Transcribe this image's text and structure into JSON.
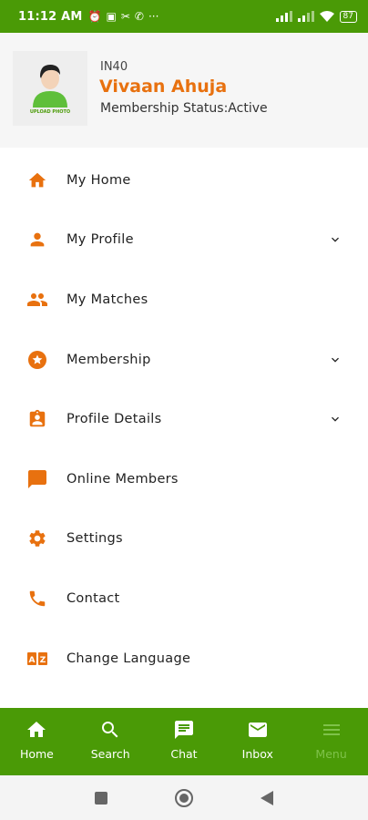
{
  "status_bar": {
    "time": "11:12 AM",
    "battery": "87"
  },
  "profile": {
    "upload_text": "UPLOAD PHOTO",
    "id": "IN40",
    "name": "Vivaan Ahuja",
    "status": "Membership Status:Active"
  },
  "colors": {
    "accent": "#e8710f",
    "brand_green": "#4a9a06"
  },
  "menu": {
    "items": [
      {
        "label": "My Home",
        "icon": "home-icon",
        "expandable": false
      },
      {
        "label": "My Profile",
        "icon": "person-icon",
        "expandable": true
      },
      {
        "label": "My Matches",
        "icon": "people-icon",
        "expandable": false
      },
      {
        "label": "Membership",
        "icon": "star-circle-icon",
        "expandable": true
      },
      {
        "label": "Profile Details",
        "icon": "badge-icon",
        "expandable": true
      },
      {
        "label": "Online Members",
        "icon": "chat-bubble-icon",
        "expandable": false
      },
      {
        "label": "Settings",
        "icon": "gear-icon",
        "expandable": false
      },
      {
        "label": "Contact",
        "icon": "phone-icon",
        "expandable": false
      },
      {
        "label": "Change Language",
        "icon": "translate-icon",
        "expandable": false
      }
    ]
  },
  "bottom_nav": {
    "items": [
      {
        "label": "Home",
        "icon": "home-icon"
      },
      {
        "label": "Search",
        "icon": "search-icon"
      },
      {
        "label": "Chat",
        "icon": "chat-icon"
      },
      {
        "label": "Inbox",
        "icon": "mail-icon"
      },
      {
        "label": "Menu",
        "icon": "menu-icon",
        "active": false
      }
    ]
  }
}
